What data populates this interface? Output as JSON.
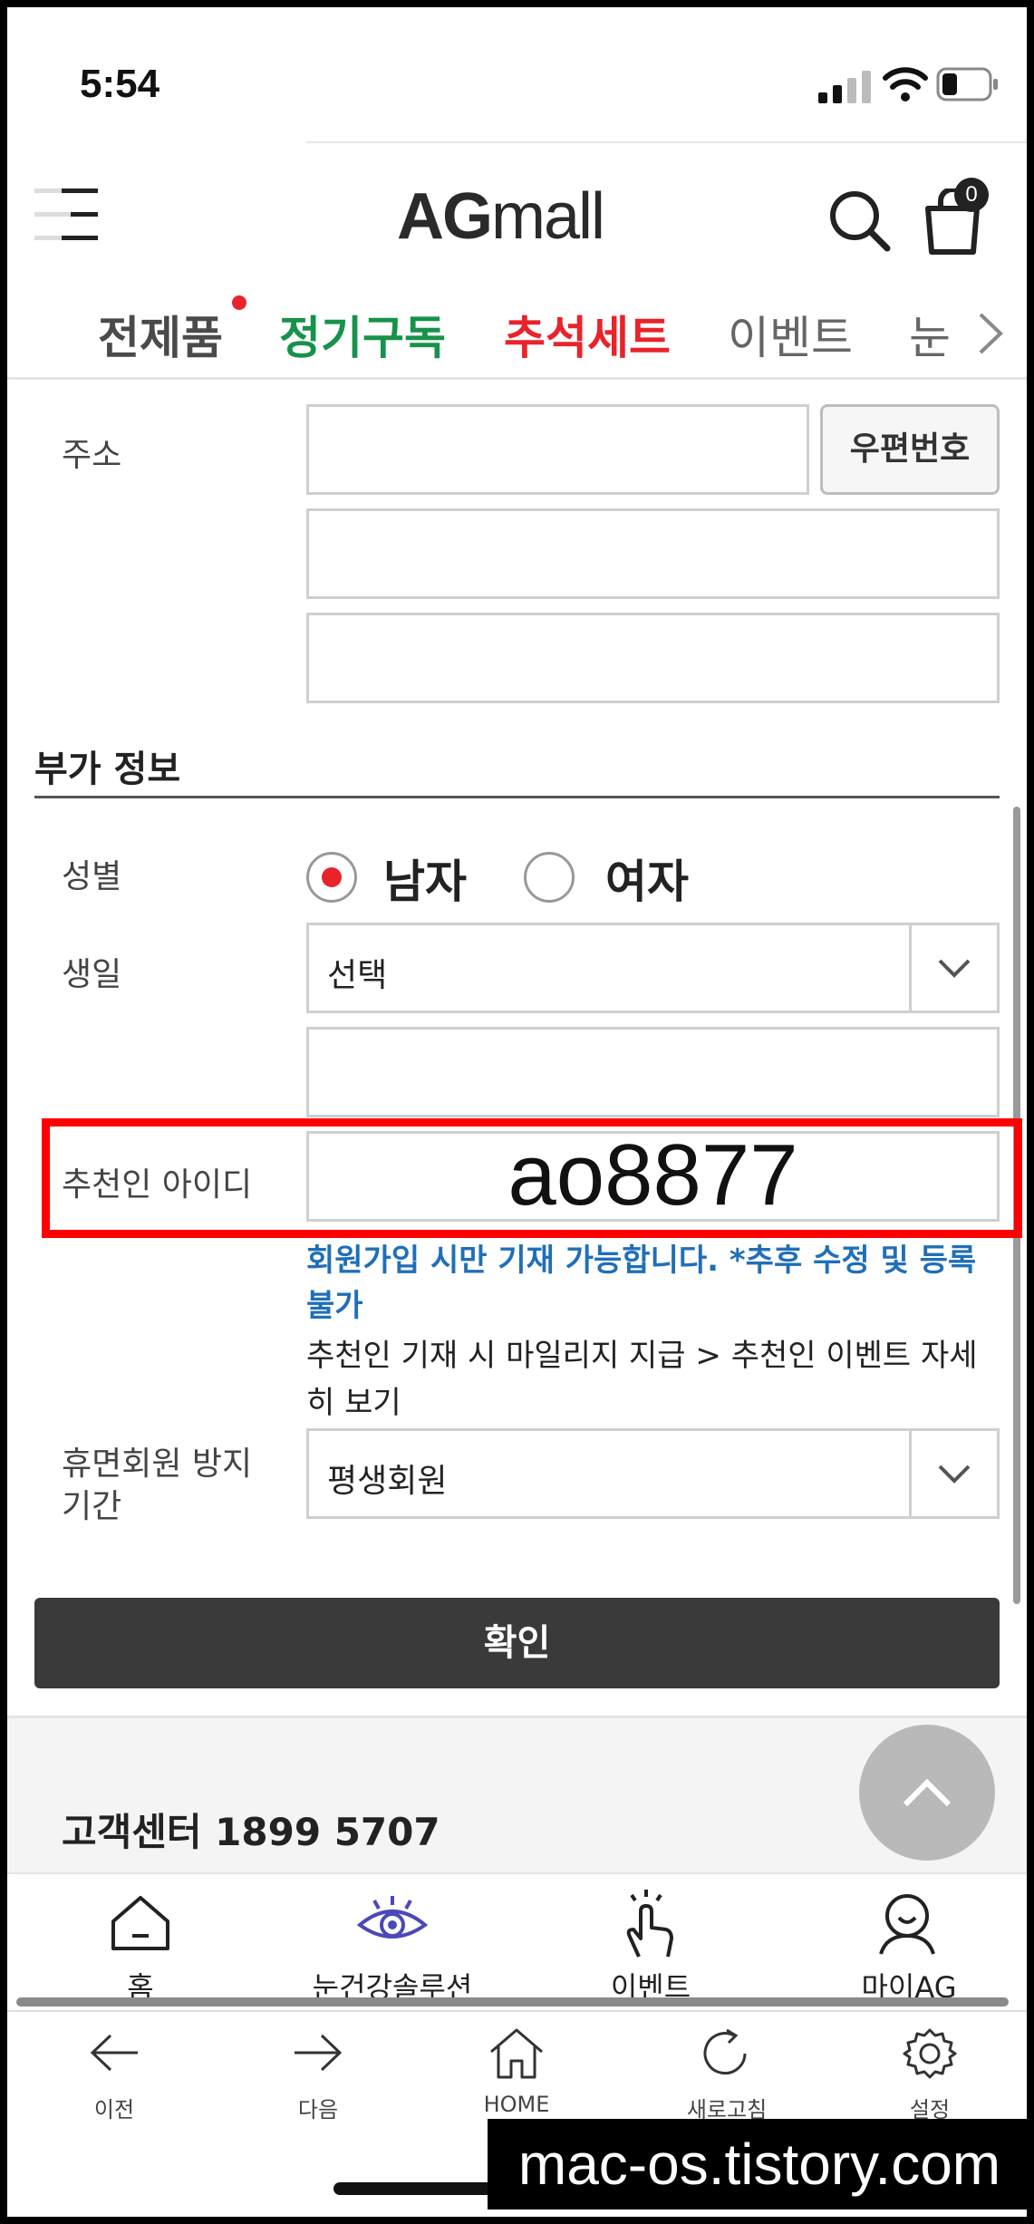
{
  "status": {
    "time": "5:54"
  },
  "header": {
    "logo_ag": "AG",
    "logo_mall": "mall",
    "cart_count": "0"
  },
  "categories": [
    {
      "label": "전제품",
      "color": "#4a4a4a"
    },
    {
      "label": "정기구독",
      "color": "#17924a"
    },
    {
      "label": "추석세트",
      "color": "#e8242a"
    },
    {
      "label": "이벤트",
      "color": "#666666"
    },
    {
      "label": "눈",
      "color": "#666666"
    }
  ],
  "form": {
    "address_label": "주소",
    "zip_button": "우편번호",
    "extra_section_title": "부가 정보",
    "gender_label": "성별",
    "gender_male": "남자",
    "gender_female": "여자",
    "birthday_label": "생일",
    "birthday_value": "선택",
    "referrer_label": "추천인 아이디",
    "referrer_value": "ao8877",
    "referrer_notice_line1": "회원가입 시만 기재 가능합니다. *추후 수정 및 등록",
    "referrer_notice_line2": "불가",
    "referrer_info_line1": "추천인 기재 시 마일리지 지급 > 추천인 이벤트 자세",
    "referrer_info_line2": "히 보기",
    "dormant_label_line1": "휴면회원 방지",
    "dormant_label_line2": "기간",
    "dormant_value": "평생회원",
    "confirm_button": "확인"
  },
  "footer": {
    "customer_center": "고객센터 1899 5707"
  },
  "bottom_nav": [
    {
      "label": "홈",
      "icon": "home-icon"
    },
    {
      "label": "눈건강솔루션",
      "icon": "eye-icon"
    },
    {
      "label": "이벤트",
      "icon": "hand-tap-icon"
    },
    {
      "label": "마이AG",
      "icon": "user-icon"
    }
  ],
  "browser_bar": [
    {
      "label": "이전",
      "icon": "arrow-left-icon"
    },
    {
      "label": "다음",
      "icon": "arrow-right-icon"
    },
    {
      "label": "HOME",
      "icon": "house-icon"
    },
    {
      "label": "새로고침",
      "icon": "refresh-icon"
    },
    {
      "label": "설정",
      "icon": "gear-icon"
    }
  ],
  "watermark": "mac-os.tistory.com",
  "colors": {
    "accent_red": "#e8242a",
    "notice_blue": "#1f6fb8",
    "confirm_bg": "#3a3a3a"
  }
}
